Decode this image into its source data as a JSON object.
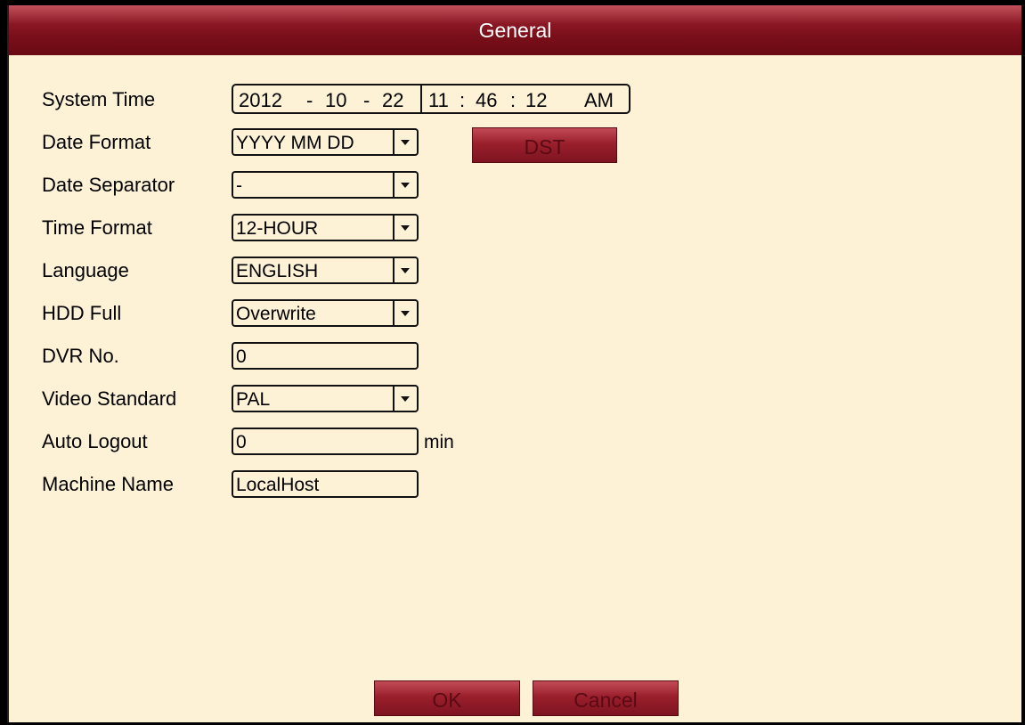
{
  "window": {
    "title": "General"
  },
  "system_time": {
    "label": "System Time",
    "year": "2012",
    "sep1": "-",
    "month": "10",
    "sep2": "-",
    "day": "22",
    "hour": "11",
    "colon1": ":",
    "minute": "46",
    "colon2": ":",
    "second": "12",
    "ampm": "AM"
  },
  "date_format": {
    "label": "Date Format",
    "value": "YYYY MM DD"
  },
  "dst_button": {
    "label": "DST"
  },
  "date_separator": {
    "label": "Date Separator",
    "value": "-"
  },
  "time_format": {
    "label": "Time Format",
    "value": "12-HOUR"
  },
  "language": {
    "label": "Language",
    "value": "ENGLISH"
  },
  "hdd_full": {
    "label": "HDD Full",
    "value": "Overwrite"
  },
  "dvr_no": {
    "label": "DVR No.",
    "value": "0"
  },
  "video_standard": {
    "label": "Video Standard",
    "value": "PAL"
  },
  "auto_logout": {
    "label": "Auto Logout",
    "value": "0",
    "unit": "min"
  },
  "machine_name": {
    "label": "Machine Name",
    "value": "LocalHost"
  },
  "footer": {
    "ok_label": "OK",
    "cancel_label": "Cancel"
  }
}
